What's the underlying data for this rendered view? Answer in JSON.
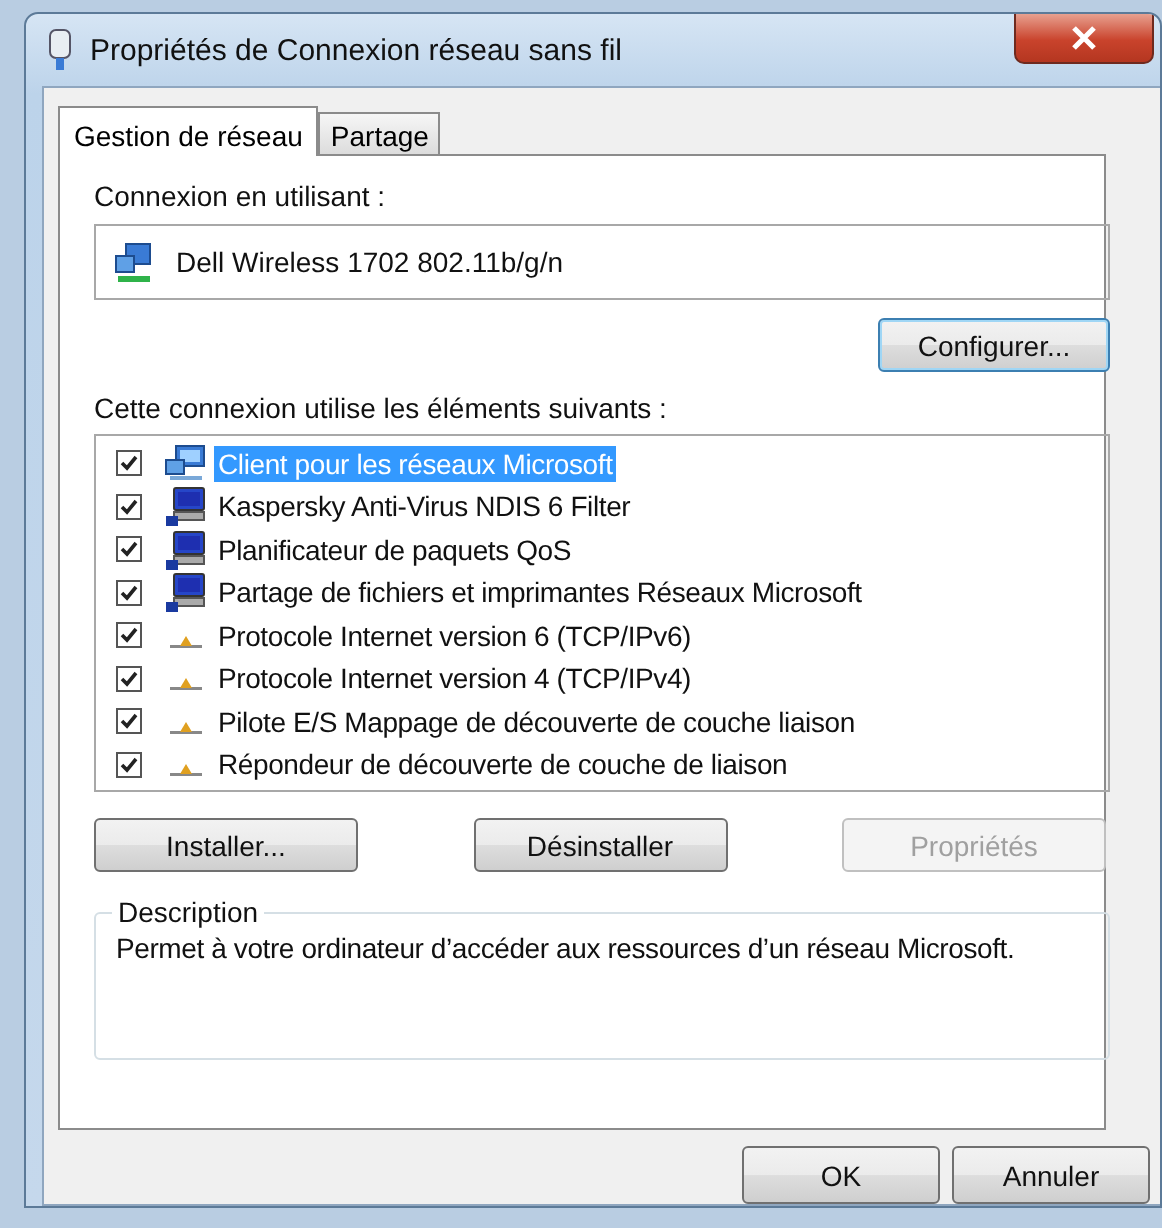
{
  "window": {
    "title": "Propriétés de Connexion réseau sans fil"
  },
  "tabs": [
    {
      "label": "Gestion de réseau",
      "selected": true
    },
    {
      "label": "Partage",
      "selected": false
    }
  ],
  "adapter_label": "Connexion en utilisant :",
  "adapter": "Dell Wireless 1702 802.11b/g/n",
  "configure_button": "Configurer...",
  "components_label": "Cette connexion utilise les éléments suivants :",
  "components": [
    {
      "label": "Client pour les réseaux Microsoft",
      "kind": "client",
      "checked": true,
      "selected": true
    },
    {
      "label": "Kaspersky Anti-Virus NDIS 6 Filter",
      "kind": "service",
      "checked": true,
      "selected": false
    },
    {
      "label": "Planificateur de paquets QoS",
      "kind": "service",
      "checked": true,
      "selected": false
    },
    {
      "label": "Partage de fichiers et imprimantes Réseaux Microsoft",
      "kind": "service",
      "checked": true,
      "selected": false
    },
    {
      "label": "Protocole Internet version 6 (TCP/IPv6)",
      "kind": "protocol",
      "checked": true,
      "selected": false
    },
    {
      "label": "Protocole Internet version 4 (TCP/IPv4)",
      "kind": "protocol",
      "checked": true,
      "selected": false
    },
    {
      "label": "Pilote E/S Mappage de découverte de couche liaison",
      "kind": "protocol",
      "checked": true,
      "selected": false
    },
    {
      "label": "Répondeur de découverte de couche de liaison",
      "kind": "protocol",
      "checked": true,
      "selected": false
    }
  ],
  "component_buttons": [
    {
      "label": "Installer...",
      "disabled": false
    },
    {
      "label": "Désinstaller",
      "disabled": false
    },
    {
      "label": "Propriétés",
      "disabled": true
    }
  ],
  "description": {
    "legend": "Description",
    "text": "Permet à votre ordinateur d’accéder aux ressources d’un réseau Microsoft."
  },
  "dialog_buttons": [
    {
      "label": "OK"
    },
    {
      "label": "Annuler"
    }
  ]
}
